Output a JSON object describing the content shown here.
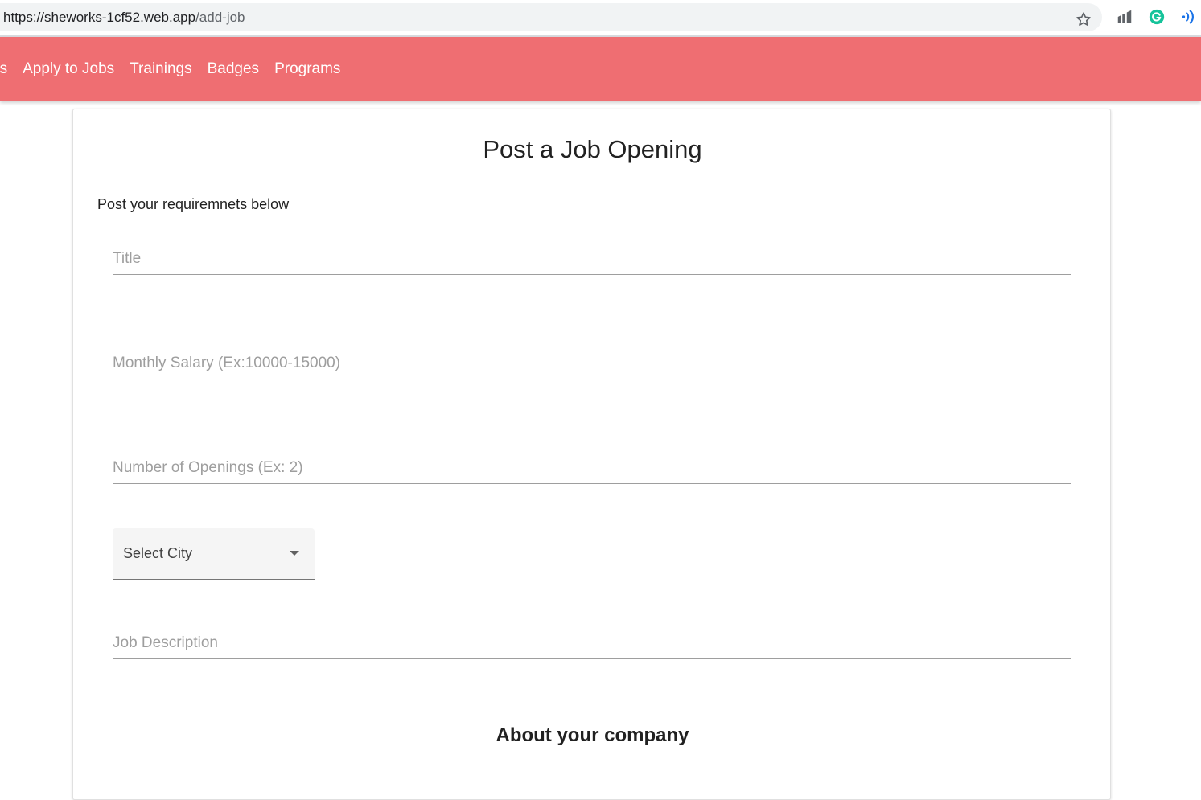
{
  "browser": {
    "url_host": "https://sheworks-1cf52.web.app",
    "url_path": "/add-job",
    "icons": [
      "star-icon",
      "analytics-extension-icon",
      "grammarly-extension-icon",
      "wave-extension-icon"
    ],
    "colors": {
      "grammarly": "#15c39a",
      "wave": "#1a73e8"
    }
  },
  "nav": {
    "items": [
      {
        "label": "os"
      },
      {
        "label": "Apply to Jobs"
      },
      {
        "label": "Trainings"
      },
      {
        "label": "Badges"
      },
      {
        "label": "Programs"
      }
    ],
    "color": "#ef6e72"
  },
  "form": {
    "title": "Post a Job Opening",
    "subtitle": "Post your requiremnets below",
    "fields": {
      "title_placeholder": "Title",
      "salary_placeholder": "Monthly Salary (Ex:10000-15000)",
      "openings_placeholder": "Number of Openings (Ex: 2)",
      "city_label": "Select City",
      "description_placeholder": "Job Description"
    },
    "company_section_title": "About your company"
  }
}
